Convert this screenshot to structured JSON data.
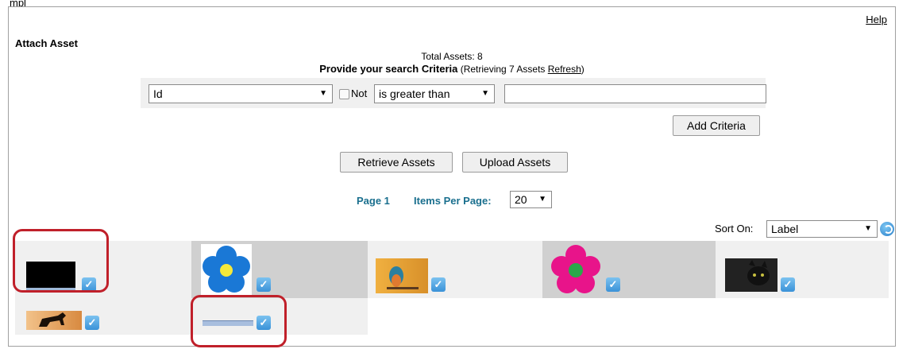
{
  "window": {
    "partial_label": "mpl"
  },
  "header": {
    "help": "Help",
    "title": "Attach Asset"
  },
  "search": {
    "total_assets": "Total Assets: 8",
    "provide_bold": "Provide your search Criteria",
    "provide_rest": " (Retrieving 7 Assets ",
    "refresh": "Refresh",
    "provide_close": ")",
    "field": "Id",
    "not_label": "Not",
    "operator": "is greater than",
    "value": "",
    "add_criteria": "Add Criteria"
  },
  "actions": {
    "retrieve": "Retrieve Assets",
    "upload": "Upload Assets"
  },
  "pager": {
    "page": "Page 1",
    "items_label": "Items Per Page:",
    "items_value": "20"
  },
  "sort": {
    "label": "Sort On:",
    "value": "Label"
  },
  "assets": [
    {
      "icon": "black-image-thumbnail",
      "checked": true
    },
    {
      "icon": "blue-flower-thumbnail",
      "checked": true
    },
    {
      "icon": "kingfisher-bird-thumbnail",
      "checked": true
    },
    {
      "icon": "pink-flower-thumbnail",
      "checked": true
    },
    {
      "icon": "black-cat-thumbnail",
      "checked": true
    },
    {
      "icon": "black-horse-thumbnail",
      "checked": true
    },
    {
      "icon": "blue-bar-thumbnail",
      "checked": true
    }
  ],
  "check_glyph": "✓",
  "dropdown_glyph": "▼",
  "colors": {
    "highlight_red": "#c0202a",
    "link_teal": "#1a6f8e",
    "checkbox_blue": "#3a92d8"
  }
}
